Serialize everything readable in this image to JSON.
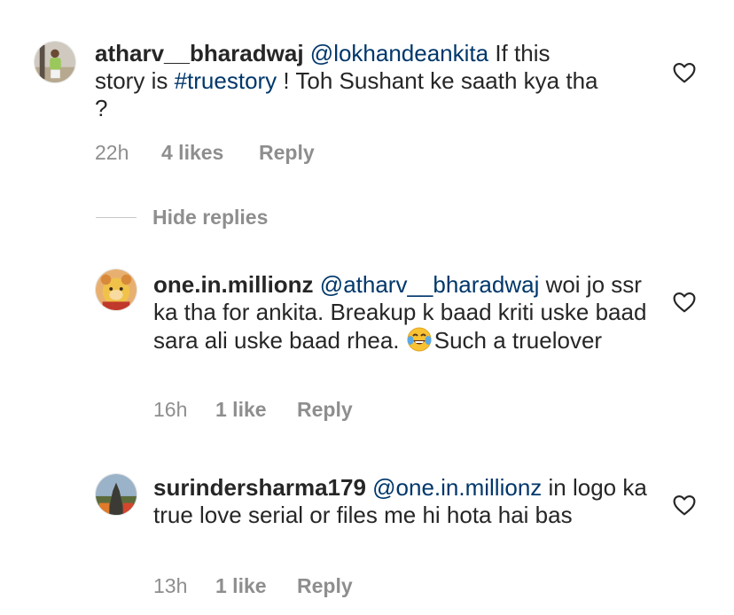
{
  "comments": [
    {
      "username": "atharv__bharadwaj",
      "mention": "@lokhandeankita",
      "text_a": " If this story is ",
      "hashtag": "#truestory",
      "text_b": " ! Toh Sushant ke saath kya tha ?",
      "time": "22h",
      "likes": "4 likes",
      "reply": "Reply"
    },
    {
      "username": "one.in.millionz",
      "mention": "@atharv__bharadwaj",
      "text_a": " woi jo ssr ka tha for ankita. Breakup k baad kriti uske baad sara ali uske baad rhea. ",
      "emoji": "face-with-tears-of-joy",
      "text_b": "Such a truelover",
      "time": "16h",
      "likes": "1 like",
      "reply": "Reply"
    },
    {
      "username": "surindersharma179",
      "mention": "@one.in.millionz",
      "text_a": " in logo ka true love serial or files me hi hota hai bas",
      "time": "13h",
      "likes": "1 like",
      "reply": "Reply"
    }
  ],
  "hide_replies_label": "Hide replies",
  "icons": {
    "like": "heart-outline-icon",
    "emoji": "tears-of-joy-emoji-icon"
  },
  "colors": {
    "text": "#262626",
    "muted": "#8e8e8e",
    "link": "#00376b"
  }
}
